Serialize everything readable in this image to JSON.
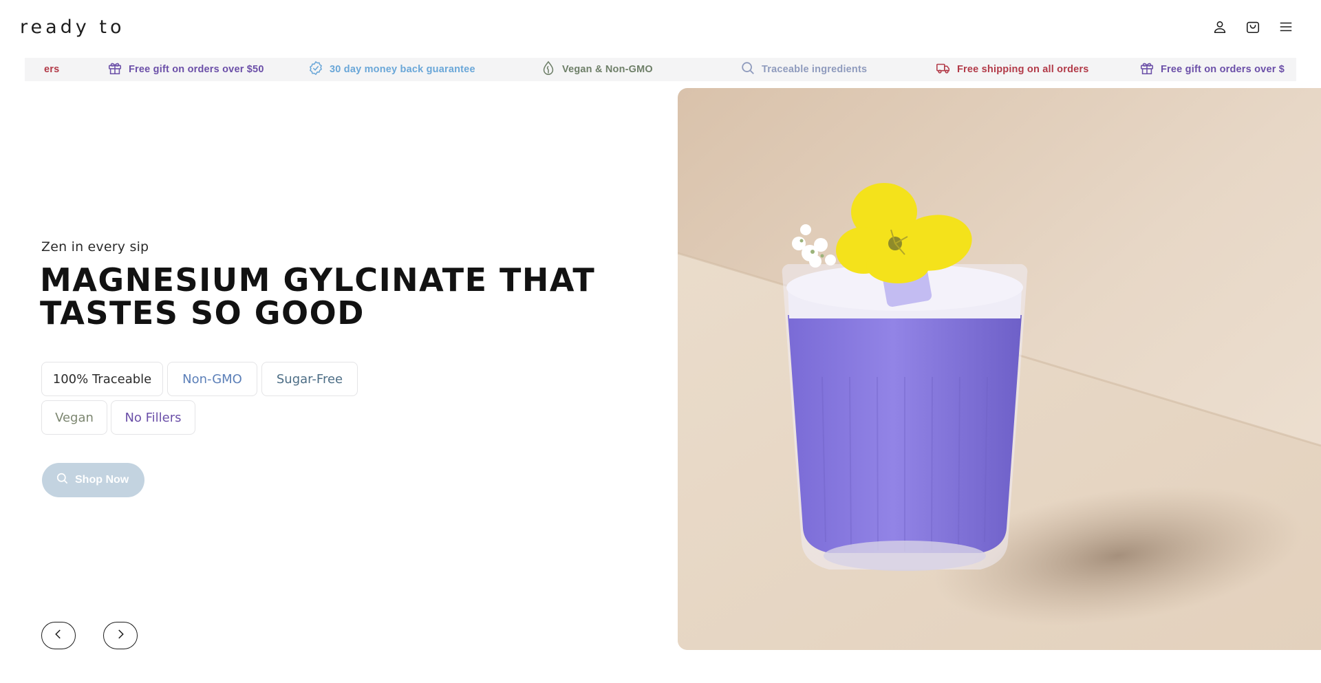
{
  "header": {
    "logo": "ready to",
    "icons": [
      "account-icon",
      "cart-icon",
      "menu-icon"
    ]
  },
  "ribbon": {
    "items": [
      {
        "label": "ers",
        "icon": "truck-icon",
        "color": "#b23a48"
      },
      {
        "label": "Free gift on orders over $50",
        "icon": "gift-icon",
        "color": "#6b4fa8"
      },
      {
        "label": "30 day money back guarantee",
        "icon": "badge-check-icon",
        "color": "#6aa7d8"
      },
      {
        "label": "Vegan & Non-GMO",
        "icon": "leaf-drop-icon",
        "color": "#6e7f68"
      },
      {
        "label": "Traceable ingredients",
        "icon": "search-icon",
        "color": "#8f9bbd"
      },
      {
        "label": "Free shipping on all orders",
        "icon": "truck-icon",
        "color": "#b23a48"
      },
      {
        "label": "Free gift on orders over $",
        "icon": "gift-icon",
        "color": "#6b4fa8"
      }
    ]
  },
  "hero": {
    "eyebrow": "Zen in every sip",
    "headline": "MAGNESIUM GYLCINATE THAT TASTES SO GOOD",
    "tags": [
      {
        "label": "100% Traceable",
        "color": "#2b2b2b"
      },
      {
        "label": "Non-GMO",
        "color": "#5b7fb8"
      },
      {
        "label": "Sugar-Free",
        "color": "#4c6d85"
      },
      {
        "label": "Vegan",
        "color": "#7c8670"
      },
      {
        "label": "No Fillers",
        "color": "#6b4fa8"
      }
    ],
    "cta": "Shop Now",
    "image_alt": "Purple magnesium drink in a ribbed glass topped with a yellow flower"
  },
  "carousel": {
    "prev_icon": "chevron-left-icon",
    "next_icon": "chevron-right-icon"
  }
}
